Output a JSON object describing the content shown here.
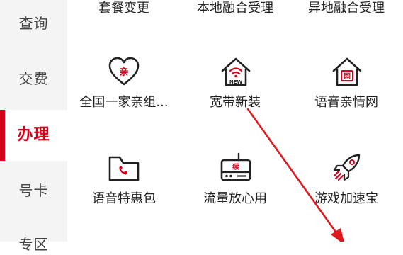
{
  "sidebar": {
    "items": [
      {
        "label": "查询"
      },
      {
        "label": "交费"
      },
      {
        "label": "办理"
      },
      {
        "label": "号卡"
      },
      {
        "label": "专区"
      }
    ]
  },
  "grid": {
    "row0": [
      "套餐变更",
      "本地融合受理",
      "异地融合受理"
    ],
    "row1": [
      "全国一家亲组...",
      "宽带新装",
      "语音亲情网"
    ],
    "row2": [
      "语音特惠包",
      "流量放心用",
      "游戏加速宝"
    ]
  },
  "icons": {
    "family": {
      "name": "heart-icon",
      "glyph": "亲"
    },
    "broadband": {
      "name": "house-wifi-icon",
      "glyph": "NEW"
    },
    "voice_network": {
      "name": "house-network-icon",
      "glyph": "网"
    },
    "voice_pack": {
      "name": "folder-phone-icon"
    },
    "data_flow": {
      "name": "router-icon",
      "glyph": "续"
    },
    "game": {
      "name": "rocket-icon"
    }
  },
  "colors": {
    "accent": "#d8001b",
    "arrow": "#e0191e"
  }
}
